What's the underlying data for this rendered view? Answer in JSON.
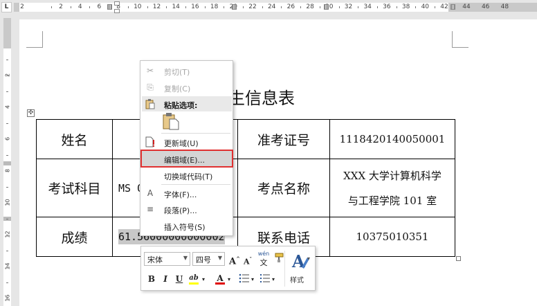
{
  "ruler": {
    "tab_selector": "L",
    "numbers_left": [
      "2"
    ],
    "numbers_main": [
      "2",
      "4",
      "6",
      "8",
      "10",
      "12",
      "14",
      "16",
      "18",
      "20",
      "22",
      "24",
      "26",
      "28",
      "30",
      "32",
      "34",
      "36",
      "38",
      "40",
      "42"
    ],
    "numbers_right": [
      "44",
      "46",
      "48"
    ],
    "vertical_numbers": [
      "2",
      "4",
      "6",
      "8",
      "10",
      "12",
      "14",
      "16"
    ]
  },
  "document": {
    "title": "生信息表",
    "table": {
      "row1": {
        "label1": "姓名",
        "label2": "准考证号",
        "value2": "1118420140050001"
      },
      "row2": {
        "label1": "考试科目",
        "value1": "MS O",
        "label2": "考点名称",
        "value2_line1": "XXX 大学计算机科学",
        "value2_line2": "与工程学院 101 室"
      },
      "row3": {
        "label1": "成绩",
        "value1": "61.56000000000002",
        "label2": "联系电话",
        "value2": "10375010351"
      }
    },
    "move_handle_icon": "✣"
  },
  "context_menu": {
    "items": [
      {
        "label": "剪切(T)",
        "icon": "✂",
        "disabled": true
      },
      {
        "label": "复制(C)",
        "icon": "⎘",
        "disabled": true
      },
      {
        "label": "粘贴选项:",
        "icon": "📋",
        "header": true
      },
      {
        "label": "更新域(U)",
        "icon": "!"
      },
      {
        "label": "编辑域(E)...",
        "icon": "",
        "highlighted": true
      },
      {
        "label": "切换域代码(T)",
        "icon": ""
      },
      {
        "label": "字体(F)...",
        "icon": "A"
      },
      {
        "label": "段落(P)...",
        "icon": "≡"
      },
      {
        "label": "插入符号(S)",
        "icon": ""
      }
    ]
  },
  "mini_toolbar": {
    "font_name": "宋体",
    "font_size": "四号",
    "grow_font": "A",
    "shrink_font": "A",
    "phonetic_top": "wén",
    "phonetic_bottom": "文",
    "bold": "B",
    "italic": "I",
    "underline": "U",
    "highlight": "ab",
    "font_color": "A",
    "styles_label": "样式",
    "highlight_color": "#ffff00",
    "font_color_value": "#e00000",
    "accent_color": "#2b5797"
  }
}
